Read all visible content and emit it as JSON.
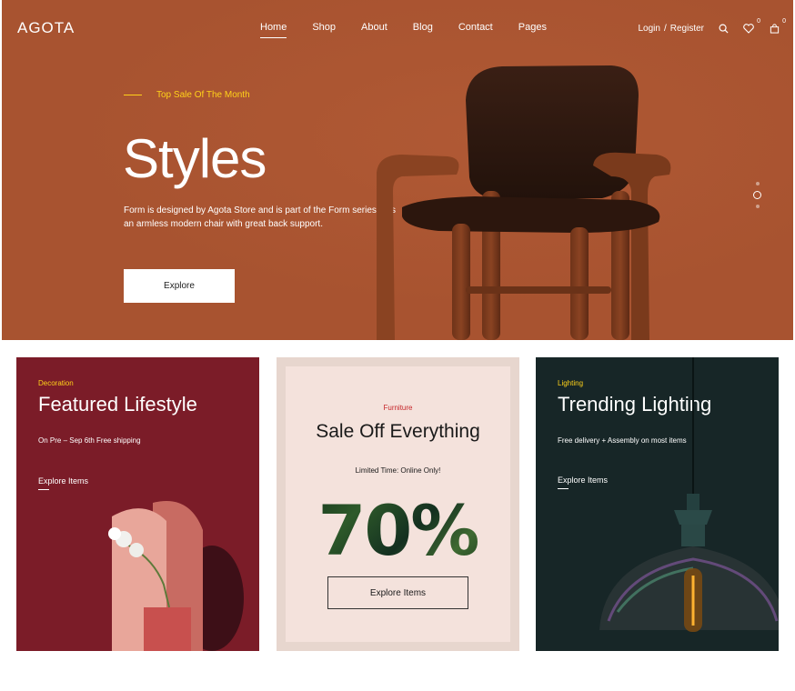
{
  "header": {
    "logo": "AGOTA",
    "nav": [
      "Home",
      "Shop",
      "About",
      "Blog",
      "Contact",
      "Pages"
    ],
    "active_nav": "Home",
    "login": "Login",
    "separator": "/",
    "register": "Register",
    "wishlist_count": "0",
    "cart_count": "0"
  },
  "hero": {
    "tagline": "Top Sale Of The Month",
    "title": "Styles",
    "description": "Form is designed by Agota Store and is part of the Form series. It is an armless modern chair with great back support.",
    "button": "Explore",
    "slide_count": 3,
    "active_slide": 2
  },
  "cards": [
    {
      "category": "Decoration",
      "title": "Featured Lifestyle",
      "subtitle": "On Pre – Sep 6th Free shipping",
      "link": "Explore Items"
    },
    {
      "category": "Furniture",
      "title": "Sale Off Everything",
      "subtitle": "Limited Time: Online Only!",
      "percent": "70%",
      "button": "Explore Items"
    },
    {
      "category": "Lighting",
      "title": "Trending Lighting",
      "subtitle": "Free delivery + Assembly on most items",
      "link": "Explore Items"
    }
  ],
  "colors": {
    "hero_bg": "#a85330",
    "accent_yellow": "#ffd21a",
    "card1_bg": "#7b1c28",
    "card2_bg": "#e7d6ce",
    "card3_bg": "#172627",
    "sale_red": "#c6262a"
  },
  "icons": [
    "search-icon",
    "heart-icon",
    "cart-icon"
  ]
}
